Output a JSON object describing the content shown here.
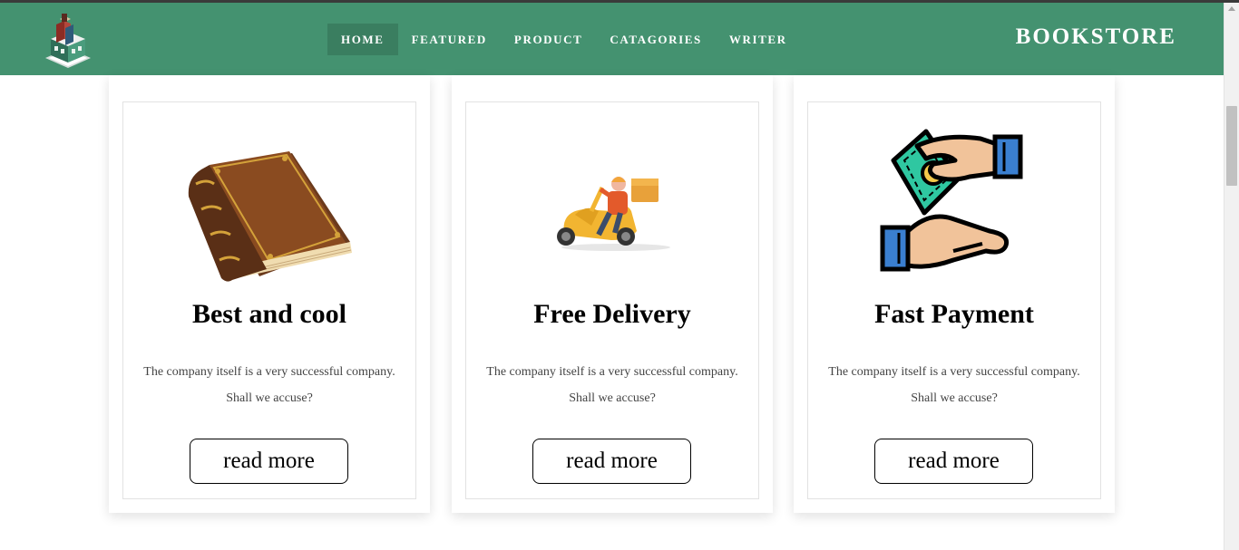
{
  "navbar": {
    "links": [
      "HOME",
      "FEATURED",
      "PRODUCT",
      "CATAGORIES",
      "WRITER"
    ],
    "active_link": "HOME",
    "brand": "BOOKSTORE",
    "color": "#449270",
    "logo_icon": "bookstore-building-icon"
  },
  "cards": [
    {
      "icon": "book-icon",
      "title": "Best and cool",
      "text_line1": "The company itself is a very successful company.",
      "text_line2": "Shall we accuse?",
      "button": "read more"
    },
    {
      "icon": "delivery-scooter-icon",
      "title": "Free Delivery",
      "text_line1": "The company itself is a very successful company.",
      "text_line2": "Shall we accuse?",
      "button": "read more"
    },
    {
      "icon": "payment-hands-icon",
      "title": "Fast Payment",
      "text_line1": "The company itself is a very successful company.",
      "text_line2": "Shall we accuse?",
      "button": "read more"
    }
  ]
}
